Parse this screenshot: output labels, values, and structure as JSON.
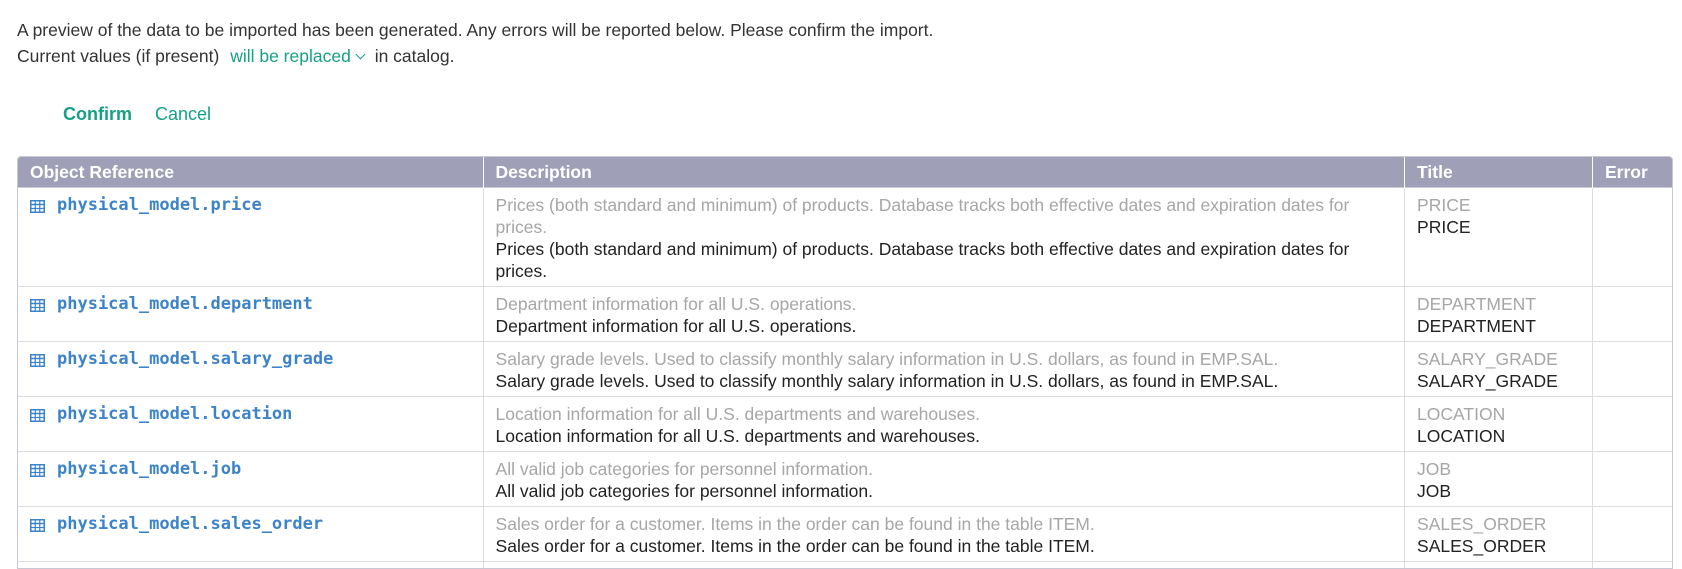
{
  "intro": {
    "line1": "A preview of the data to be imported has been generated. Any errors will be reported below. Please confirm the import.",
    "line2_prefix": "Current values (if present)",
    "replace_option": "will be replaced",
    "line2_suffix": "in catalog."
  },
  "actions": {
    "confirm_label": "Confirm",
    "cancel_label": "Cancel"
  },
  "table": {
    "columns": [
      "Object Reference",
      "Description",
      "Title",
      "Error"
    ],
    "rows": [
      {
        "reference": "physical_model.price",
        "icon": "table-icon",
        "description_old": "Prices (both standard and minimum) of products. Database tracks both effective dates and expiration dates for prices.",
        "description_new": "Prices (both standard and minimum) of products. Database tracks both effective dates and expiration dates for prices.",
        "title_old": "PRICE",
        "title_new": "PRICE",
        "error": ""
      },
      {
        "reference": "physical_model.department",
        "icon": "table-icon",
        "description_old": "Department information for all U.S. operations.",
        "description_new": "Department information for all U.S. operations.",
        "title_old": "DEPARTMENT",
        "title_new": "DEPARTMENT",
        "error": ""
      },
      {
        "reference": "physical_model.salary_grade",
        "icon": "table-icon",
        "description_old": "Salary grade levels. Used to classify monthly salary information in U.S. dollars, as found in EMP.SAL.",
        "description_new": "Salary grade levels. Used to classify monthly salary information in U.S. dollars, as found in EMP.SAL.",
        "title_old": "SALARY_GRADE",
        "title_new": "SALARY_GRADE",
        "error": ""
      },
      {
        "reference": "physical_model.location",
        "icon": "table-icon",
        "description_old": "Location information for all U.S. departments and warehouses.",
        "description_new": "Location information for all U.S. departments and warehouses.",
        "title_old": "LOCATION",
        "title_new": "LOCATION",
        "error": ""
      },
      {
        "reference": "physical_model.job",
        "icon": "table-icon",
        "description_old": "All valid job categories for personnel information.",
        "description_new": "All valid job categories for personnel information.",
        "title_old": "JOB",
        "title_new": "JOB",
        "error": ""
      },
      {
        "reference": "physical_model.sales_order",
        "icon": "table-icon",
        "description_old": "Sales order for a customer. Items in the order can be found in the table ITEM.",
        "description_new": "Sales order for a customer. Items in the order can be found in the table ITEM.",
        "title_old": "SALES_ORDER",
        "title_new": "SALES_ORDER",
        "error": ""
      }
    ]
  },
  "colors": {
    "accent": "#16a085",
    "link": "#3d83c9",
    "header_bg": "#9fa0b8",
    "old_text": "#a6a6a6"
  }
}
